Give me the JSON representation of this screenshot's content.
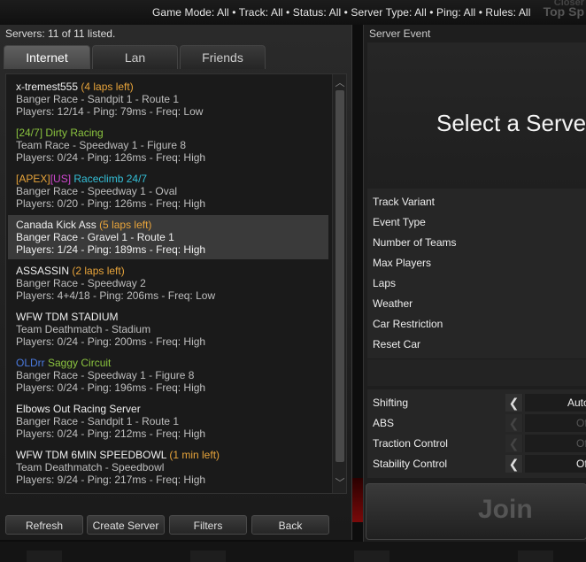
{
  "top_filters": "Game Mode: All • Track: All • Status: All • Server Type: All • Ping: All • Rules: All",
  "corner_label_top": "Closer",
  "corner_label": "Top Sp",
  "servers_count": "Servers: 11 of 11 listed.",
  "tabs": [
    {
      "label": "Internet",
      "active": true
    },
    {
      "label": "Lan",
      "active": false
    },
    {
      "label": "Friends",
      "active": false
    }
  ],
  "servers": [
    {
      "name_parts": [
        {
          "text": "x-tremest555 ",
          "color": "white"
        },
        {
          "text": "(4 laps left)",
          "color": "orange"
        }
      ],
      "details": "Banger Race - Sandpit 1 - Route 1",
      "status": "Players: 12/14 - Ping: 79ms - Freq: Low",
      "selected": false
    },
    {
      "name_parts": [
        {
          "text": "[24/7] Dirty Racing",
          "color": "green"
        }
      ],
      "details": "Team Race - Speedway 1 - Figure 8",
      "status": "Players: 0/24 - Ping: 126ms - Freq: High",
      "selected": false
    },
    {
      "name_parts": [
        {
          "text": "[APEX]",
          "color": "orange"
        },
        {
          "text": "[US]",
          "color": "pink"
        },
        {
          "text": " Raceclimb 24/7",
          "color": "cyan"
        }
      ],
      "details": "Banger Race - Speedway 1 - Oval",
      "status": "Players: 0/20 - Ping: 126ms - Freq: High",
      "selected": false
    },
    {
      "name_parts": [
        {
          "text": " Canada Kick Ass ",
          "color": "white"
        },
        {
          "text": "(5 laps left)",
          "color": "orange"
        }
      ],
      "details": "Banger Race - Gravel 1 - Route 1",
      "status": "Players: 1/24 - Ping: 189ms - Freq: High",
      "selected": true
    },
    {
      "name_parts": [
        {
          "text": "ASSASSIN ",
          "color": "white"
        },
        {
          "text": "(2 laps left)",
          "color": "orange"
        }
      ],
      "details": "Banger Race - Speedway 2",
      "status": "Players: 4+4/18 - Ping: 206ms - Freq: Low",
      "selected": false
    },
    {
      "name_parts": [
        {
          "text": "WFW TDM STADIUM",
          "color": "white"
        }
      ],
      "details": "Team Deathmatch - Stadium",
      "status": "Players: 0/24 - Ping: 200ms - Freq: High",
      "selected": false
    },
    {
      "name_parts": [
        {
          "text": "OLDrr",
          "color": "blue"
        },
        {
          "text": " Saggy Circuit",
          "color": "green"
        }
      ],
      "details": "Banger Race - Speedway 1 - Figure 8",
      "status": "Players: 0/24 - Ping: 196ms - Freq: High",
      "selected": false
    },
    {
      "name_parts": [
        {
          "text": "Elbows Out Racing Server",
          "color": "white"
        }
      ],
      "details": "Banger Race - Sandpit 1 - Route 1",
      "status": "Players: 0/24 - Ping: 212ms - Freq: High",
      "selected": false
    },
    {
      "name_parts": [
        {
          "text": "WFW TDM 6MIN SPEEDBOWL ",
          "color": "white"
        },
        {
          "text": "(1 min left)",
          "color": "orange"
        }
      ],
      "details": "Team Deathmatch - Speedbowl",
      "status": "Players: 9/24 - Ping: 217ms - Freq: High",
      "selected": false
    }
  ],
  "buttons": {
    "refresh": "Refresh",
    "create_server": "Create Server",
    "filters": "Filters",
    "back": "Back"
  },
  "server_event": {
    "title": "Server Event",
    "message": "Select a Server.",
    "info_labels": [
      "Track Variant",
      "Event Type",
      "Number of Teams",
      "Max Players",
      "Laps",
      "Weather",
      "Car Restriction",
      "Reset Car"
    ]
  },
  "settings": [
    {
      "label": "Shifting",
      "value": "Automatic",
      "enabled": true
    },
    {
      "label": "ABS",
      "value": "Off",
      "enabled": false
    },
    {
      "label": "Traction Control",
      "value": "Off",
      "enabled": false
    },
    {
      "label": "Stability Control",
      "value": "Off",
      "enabled": true
    }
  ],
  "join_label": "Join",
  "colors": {
    "white": "#f0f0f0",
    "orange": "#e8a43a",
    "green": "#8bc43f",
    "red": "#e04a3a",
    "pink": "#d047d0",
    "cyan": "#34c0d8",
    "blue": "#4a7ae0"
  }
}
